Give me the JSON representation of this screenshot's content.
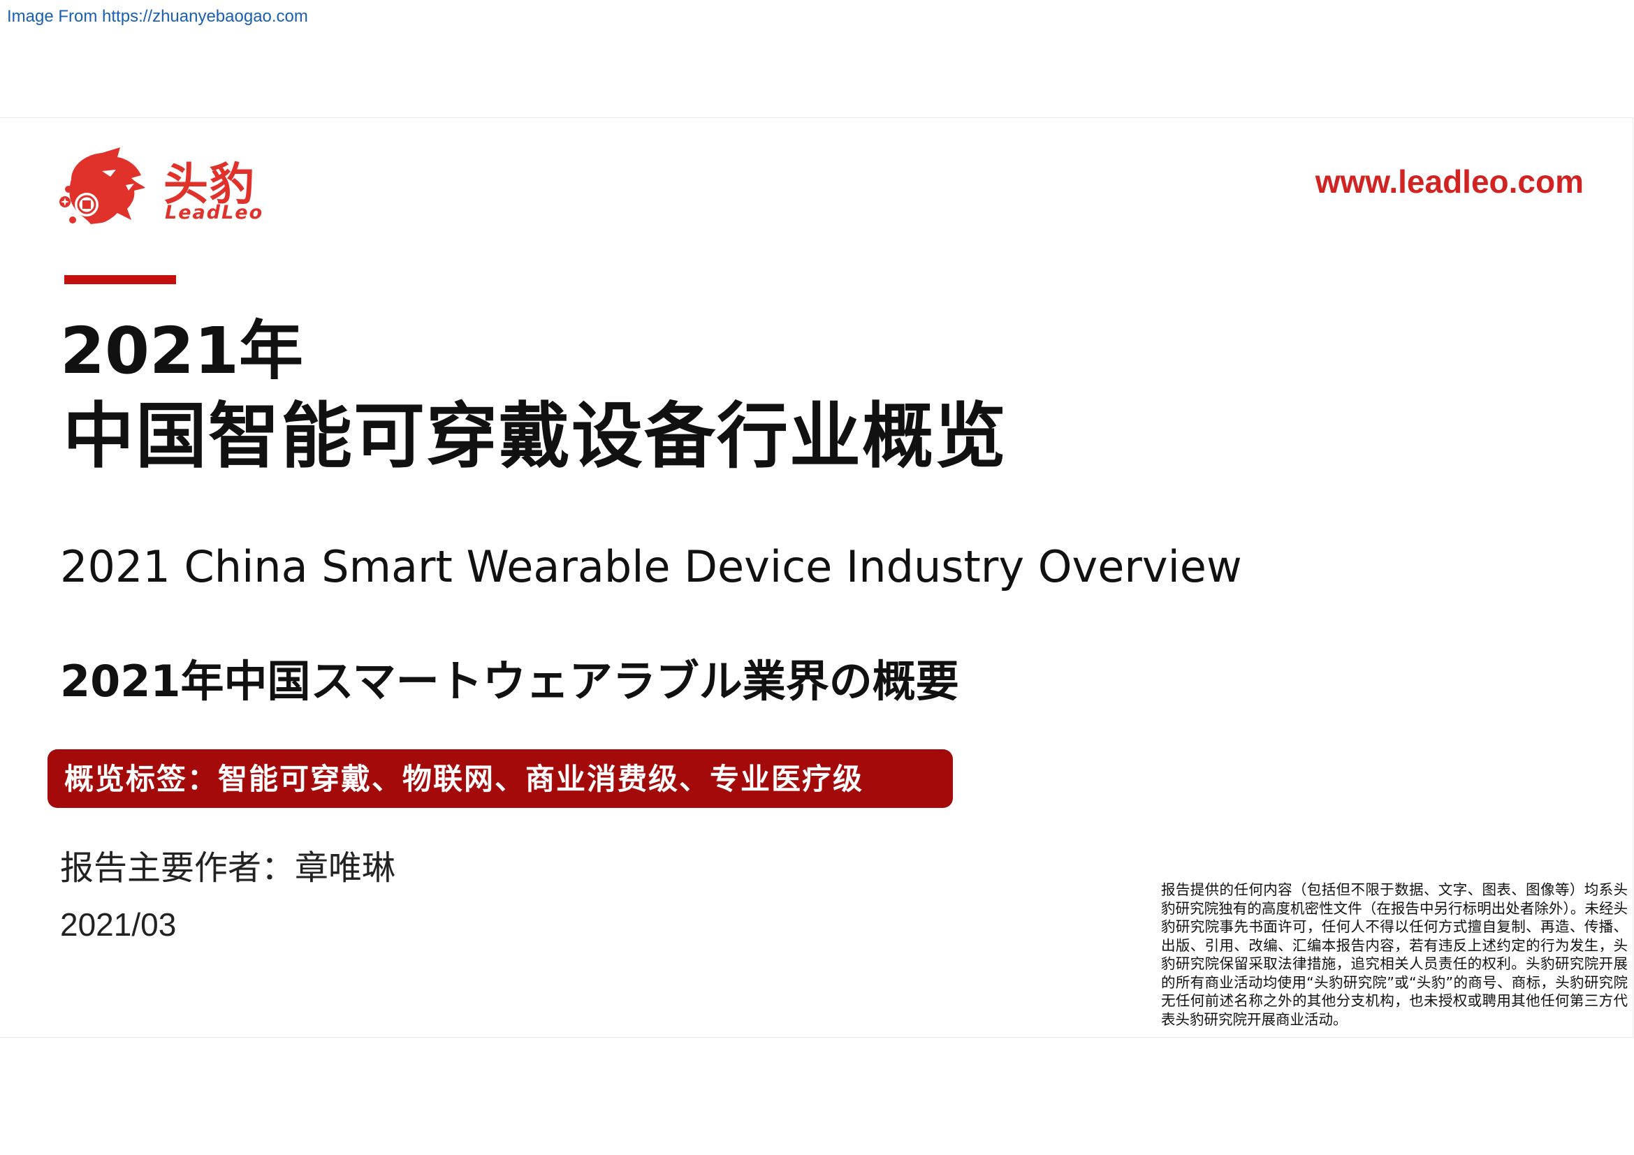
{
  "source": {
    "text": "Image From https://zhuanyebaogao.com"
  },
  "header": {
    "logo": {
      "cn": "头豹",
      "en": "LeadLeo",
      "brand_color": "#e0312b"
    },
    "website": "www.leadleo.com"
  },
  "title": {
    "year": "2021年",
    "cn": "中国智能可穿戴设备行业概览",
    "en": "2021 China Smart Wearable Device Industry Overview",
    "jp": "2021年中国スマートウェアラブル業界の概要"
  },
  "tags": {
    "text": "概览标签：智能可穿戴、物联网、商业消费级、专业医疗级",
    "bg_color": "#a50a0a"
  },
  "meta": {
    "author": "报告主要作者：章唯琳",
    "date": "2021/03"
  },
  "disclaimer": "报告提供的任何内容（包括但不限于数据、文字、图表、图像等）均系头豹研究院独有的高度机密性文件（在报告中另行标明出处者除外）。未经头豹研究院事先书面许可，任何人不得以任何方式擅自复制、再造、传播、出版、引用、改编、汇编本报告内容，若有违反上述约定的行为发生，头豹研究院保留采取法律措施，追究相关人员责任的权利。头豹研究院开展的所有商业活动均使用“头豹研究院”或“头豹”的商号、商标，头豹研究院无任何前述名称之外的其他分支机构，也未授权或聘用其他任何第三方代表头豹研究院开展商业活动。",
  "colors": {
    "accent": "#c40f0f",
    "link": "#d22323"
  }
}
